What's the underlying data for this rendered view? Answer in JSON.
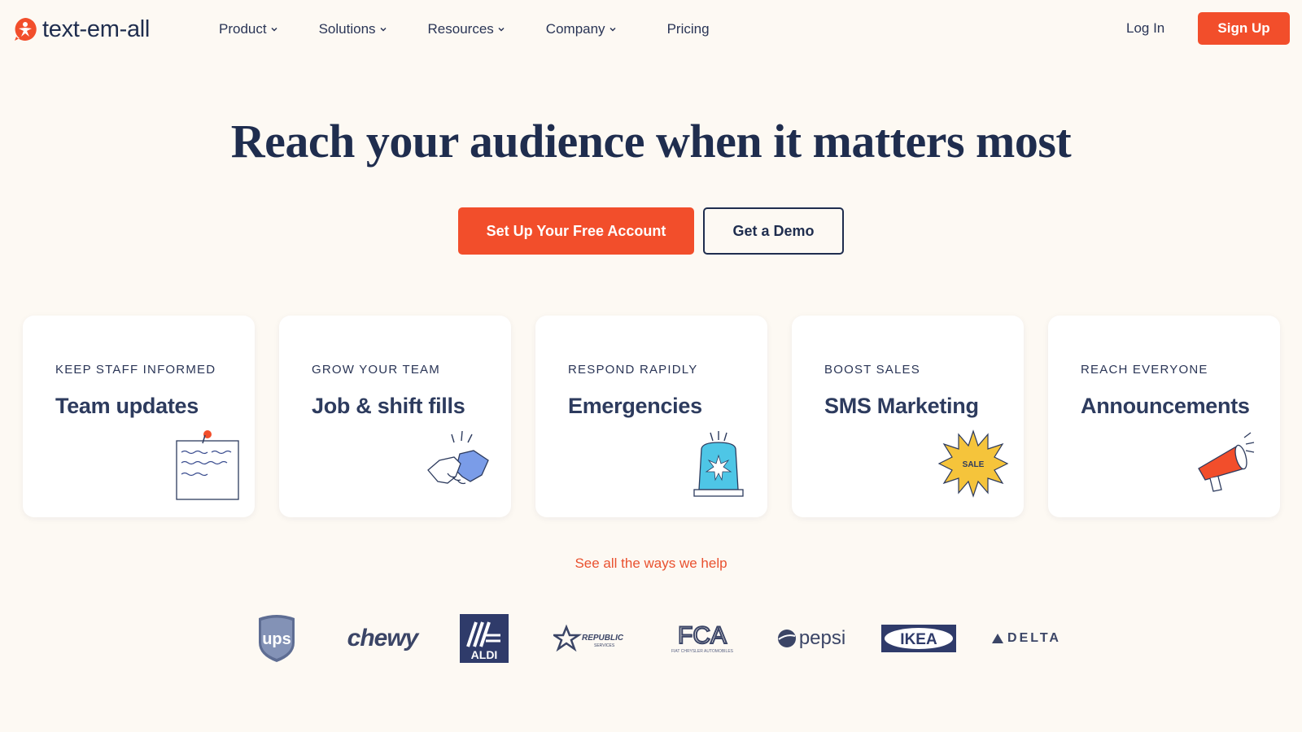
{
  "brand": {
    "name": "text-em-all",
    "accent": "#f24e2b",
    "navy": "#1f2d4e",
    "background": "#fdf9f3"
  },
  "nav": {
    "items": [
      {
        "label": "Product",
        "has_dropdown": true
      },
      {
        "label": "Solutions",
        "has_dropdown": true
      },
      {
        "label": "Resources",
        "has_dropdown": true
      },
      {
        "label": "Company",
        "has_dropdown": true
      },
      {
        "label": "Pricing",
        "has_dropdown": false
      }
    ],
    "login_label": "Log In",
    "signup_label": "Sign Up"
  },
  "hero": {
    "title": "Reach your audience when it matters most",
    "primary_cta": "Set Up Your Free Account",
    "secondary_cta": "Get a Demo"
  },
  "cards": [
    {
      "kicker": "KEEP STAFF INFORMED",
      "title": "Team updates",
      "icon": "pinned-note-icon"
    },
    {
      "kicker": "GROW YOUR TEAM",
      "title": "Job & shift fills",
      "icon": "handshake-icon"
    },
    {
      "kicker": "RESPOND RAPIDLY",
      "title": "Emergencies",
      "icon": "siren-icon"
    },
    {
      "kicker": "BOOST SALES",
      "title": "SMS Marketing",
      "icon": "sale-badge-icon",
      "badge_text": "SALE"
    },
    {
      "kicker": "REACH EVERYONE",
      "title": "Announcements",
      "icon": "megaphone-icon"
    }
  ],
  "see_all_label": "See all the ways we help",
  "customer_logos": [
    {
      "name": "ups",
      "text": "ups"
    },
    {
      "name": "chewy",
      "text": "chewy"
    },
    {
      "name": "aldi",
      "text": "ALDI"
    },
    {
      "name": "republic-services",
      "text": "REPUBLIC",
      "subtext": "SERVICES"
    },
    {
      "name": "fca",
      "text": "FCA",
      "subtext": "FIAT CHRYSLER AUTOMOBILES"
    },
    {
      "name": "pepsi",
      "text": "pepsi"
    },
    {
      "name": "ikea",
      "text": "IKEA"
    },
    {
      "name": "delta",
      "text": "DELTA"
    }
  ]
}
